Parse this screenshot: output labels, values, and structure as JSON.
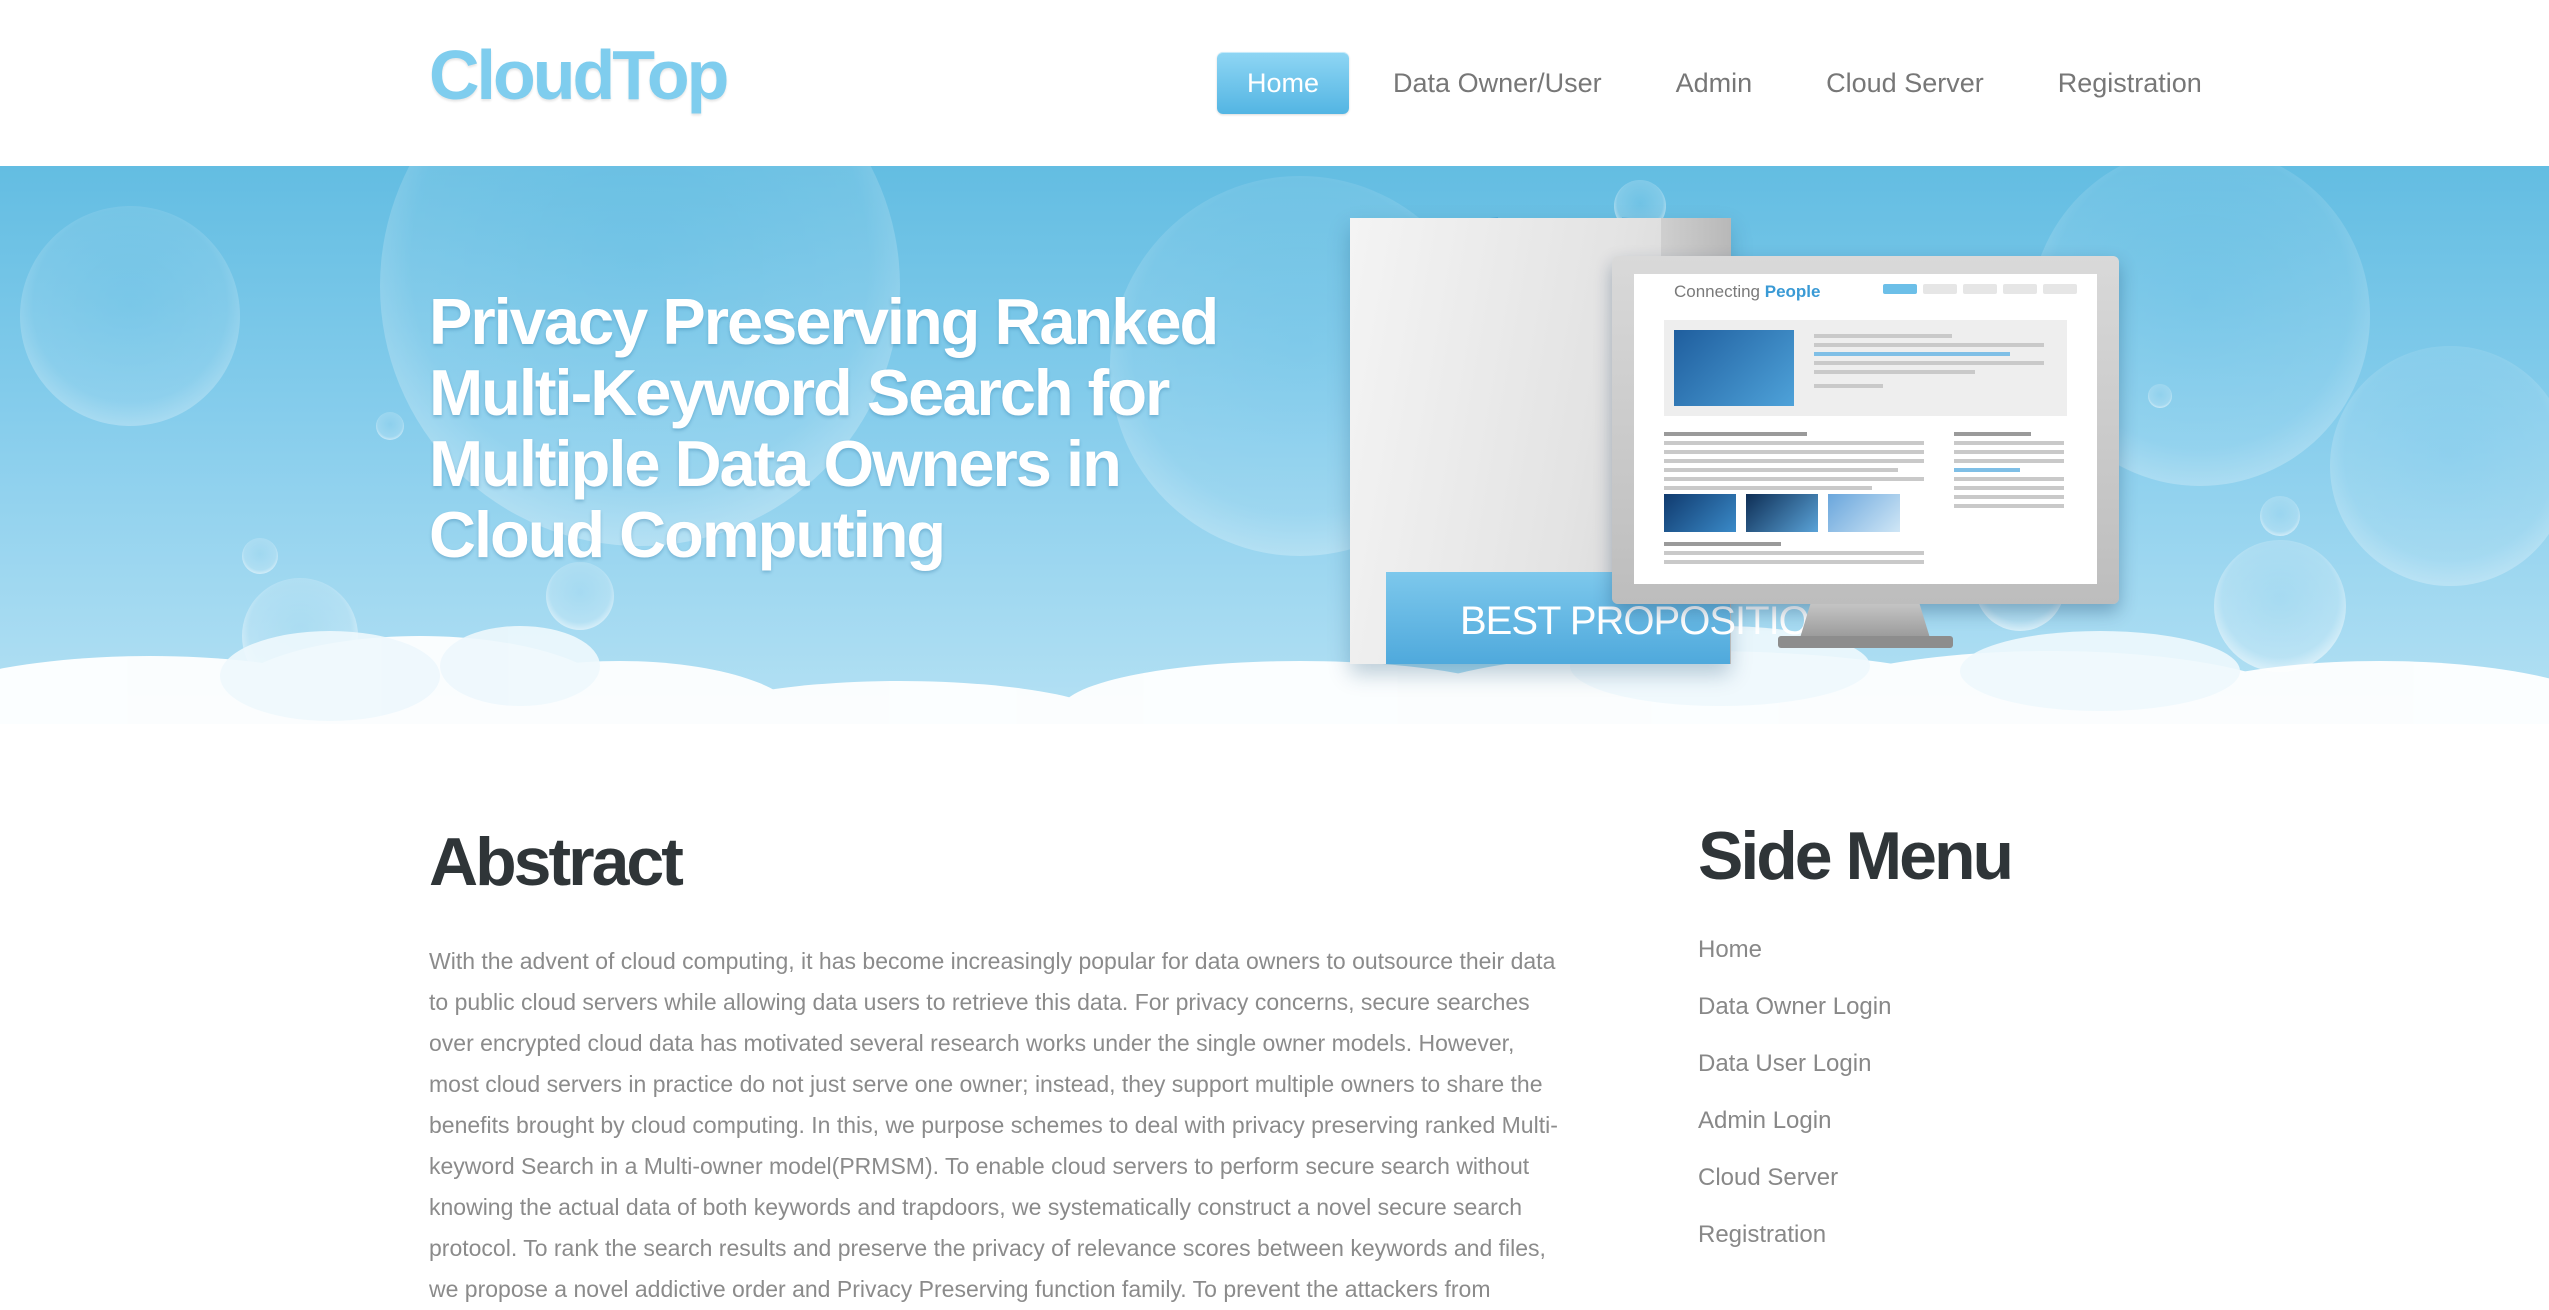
{
  "header": {
    "logo": "CloudTop",
    "nav": [
      {
        "label": "Home",
        "active": true
      },
      {
        "label": "Data Owner/User",
        "active": false
      },
      {
        "label": "Admin",
        "active": false
      },
      {
        "label": "Cloud Server",
        "active": false
      },
      {
        "label": "Registration",
        "active": false
      }
    ]
  },
  "banner": {
    "title": "Privacy Preserving Ranked Multi-Keyword Search for Multiple Data Owners in Cloud Computing",
    "illustration": {
      "bag_label": "BEST PROPOSITION",
      "screen_title_prefix": "Connecting ",
      "screen_title_emphasis": "People"
    }
  },
  "abstract": {
    "heading": "Abstract",
    "text": "With the advent of cloud computing, it has become increasingly popular for data owners to outsource their data to public cloud servers while allowing data users to retrieve this data. For privacy concerns, secure searches over encrypted cloud data has motivated several research works under the single owner models. However, most cloud servers in practice do not just serve one owner; instead, they support multiple owners to share the benefits brought by cloud computing. In this, we purpose schemes to deal with privacy preserving ranked Multi-keyword Search in a Multi-owner model(PRMSM). To enable cloud servers to perform secure search without knowing the actual data of both keywords and trapdoors, we systematically construct a novel secure search protocol. To rank the search results and preserve the privacy of relevance scores between keywords and files, we propose a novel addictive order and Privacy Preserving function family. To prevent the attackers from"
  },
  "side_menu": {
    "heading": "Side Menu",
    "items": [
      "Home",
      "Data Owner Login",
      "Data User Login",
      "Admin Login",
      "Cloud Server",
      "Registration"
    ]
  },
  "colors": {
    "brand": "#7fcdee",
    "nav_active": "#53b5e3",
    "banner_sky": "#63bde2",
    "heading": "#2f3538",
    "body_text": "#8b8b8b"
  }
}
